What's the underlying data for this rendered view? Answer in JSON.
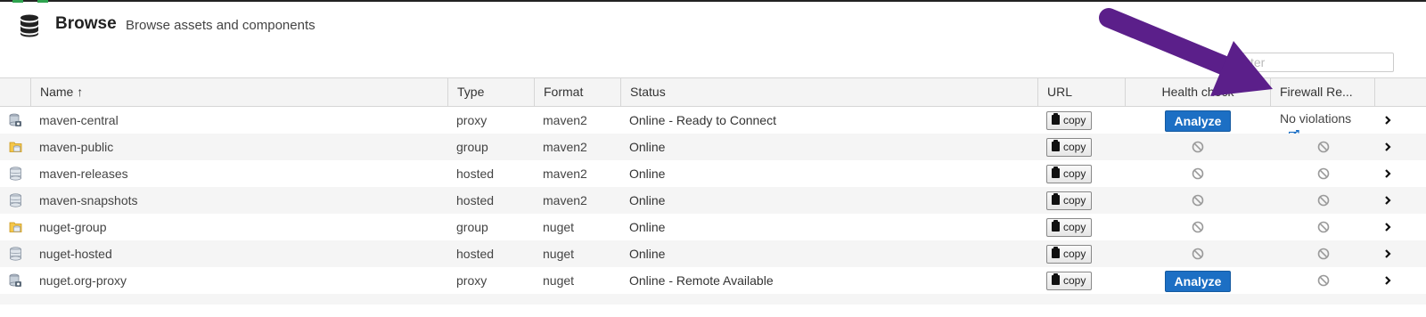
{
  "header": {
    "title": "Browse",
    "subtitle": "Browse assets and components",
    "icon": "database-icon"
  },
  "filter": {
    "placeholder": "Filter",
    "visible_text": "ter"
  },
  "columns": {
    "name": "Name ↑",
    "type": "Type",
    "format": "Format",
    "status": "Status",
    "url": "URL",
    "health": "Health check",
    "firewall": "Firewall Re..."
  },
  "copy_label": "copy",
  "analyze_label": "Analyze",
  "rows": [
    {
      "icon": "proxy-repo-icon",
      "name": "maven-central",
      "type": "proxy",
      "format": "maven2",
      "status": "Online - Ready to Connect",
      "health": "analyze",
      "firewall": "No violations"
    },
    {
      "icon": "group-repo-icon",
      "name": "maven-public",
      "type": "group",
      "format": "maven2",
      "status": "Online",
      "health": "na",
      "firewall": "na"
    },
    {
      "icon": "hosted-repo-icon",
      "name": "maven-releases",
      "type": "hosted",
      "format": "maven2",
      "status": "Online",
      "health": "na",
      "firewall": "na"
    },
    {
      "icon": "hosted-repo-icon",
      "name": "maven-snapshots",
      "type": "hosted",
      "format": "maven2",
      "status": "Online",
      "health": "na",
      "firewall": "na"
    },
    {
      "icon": "group-repo-icon",
      "name": "nuget-group",
      "type": "group",
      "format": "nuget",
      "status": "Online",
      "health": "na",
      "firewall": "na"
    },
    {
      "icon": "hosted-repo-icon",
      "name": "nuget-hosted",
      "type": "hosted",
      "format": "nuget",
      "status": "Online",
      "health": "na",
      "firewall": "na"
    },
    {
      "icon": "proxy-repo-icon",
      "name": "nuget.org-proxy",
      "type": "proxy",
      "format": "nuget",
      "status": "Online - Remote Available",
      "health": "analyze",
      "firewall": "na"
    }
  ],
  "colors": {
    "accent_arrow": "#5b1f8a",
    "analyze_bg": "#1c6fc4"
  }
}
